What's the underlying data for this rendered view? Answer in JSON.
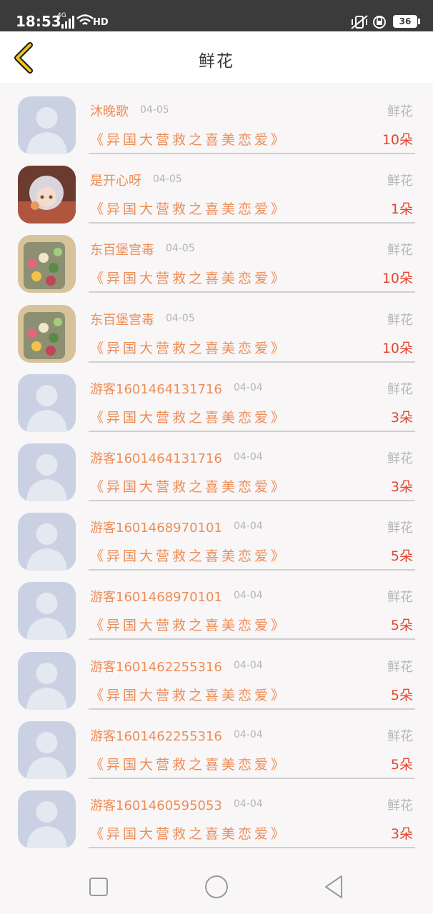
{
  "status_bar": {
    "time": "18:53",
    "network": "4G",
    "hd": "HD",
    "battery": "36"
  },
  "header": {
    "title": "鲜花",
    "back_icon": "chevron-left-icon",
    "accent_color": "#f2c21b"
  },
  "colors": {
    "name": "#ee8d57",
    "count": "#e5452f",
    "muted": "#b5b5b5"
  },
  "gifts": [
    {
      "name": "沐晚歌",
      "date": "04-05",
      "type": "鲜花",
      "book": "《异国大营救之喜美恋爱》",
      "count": "10朵",
      "avatar": "default-avatar"
    },
    {
      "name": "是开心呀",
      "date": "04-05",
      "type": "鲜花",
      "book": "《异国大营救之喜美恋爱》",
      "count": "1朵",
      "avatar": "anime-girl-avatar"
    },
    {
      "name": "东百堡宫毒",
      "date": "04-05",
      "type": "鲜花",
      "book": "《异国大营救之喜美恋爱》",
      "count": "10朵",
      "avatar": "candy-jar-avatar"
    },
    {
      "name": "东百堡宫毒",
      "date": "04-05",
      "type": "鲜花",
      "book": "《异国大营救之喜美恋爱》",
      "count": "10朵",
      "avatar": "candy-jar-avatar"
    },
    {
      "name": "游客1601464131716",
      "date": "04-04",
      "type": "鲜花",
      "book": "《异国大营救之喜美恋爱》",
      "count": "3朵",
      "avatar": "default-avatar"
    },
    {
      "name": "游客1601464131716",
      "date": "04-04",
      "type": "鲜花",
      "book": "《异国大营救之喜美恋爱》",
      "count": "3朵",
      "avatar": "default-avatar"
    },
    {
      "name": "游客1601468970101",
      "date": "04-04",
      "type": "鲜花",
      "book": "《异国大营救之喜美恋爱》",
      "count": "5朵",
      "avatar": "default-avatar"
    },
    {
      "name": "游客1601468970101",
      "date": "04-04",
      "type": "鲜花",
      "book": "《异国大营救之喜美恋爱》",
      "count": "5朵",
      "avatar": "default-avatar"
    },
    {
      "name": "游客1601462255316",
      "date": "04-04",
      "type": "鲜花",
      "book": "《异国大营救之喜美恋爱》",
      "count": "5朵",
      "avatar": "default-avatar"
    },
    {
      "name": "游客1601462255316",
      "date": "04-04",
      "type": "鲜花",
      "book": "《异国大营救之喜美恋爱》",
      "count": "5朵",
      "avatar": "default-avatar"
    },
    {
      "name": "游客1601460595053",
      "date": "04-04",
      "type": "鲜花",
      "book": "《异国大营救之喜美恋爱》",
      "count": "3朵",
      "avatar": "default-avatar"
    }
  ],
  "nav_bar": {
    "recents_icon": "square-icon",
    "home_icon": "circle-icon",
    "back_icon": "triangle-back-icon"
  }
}
